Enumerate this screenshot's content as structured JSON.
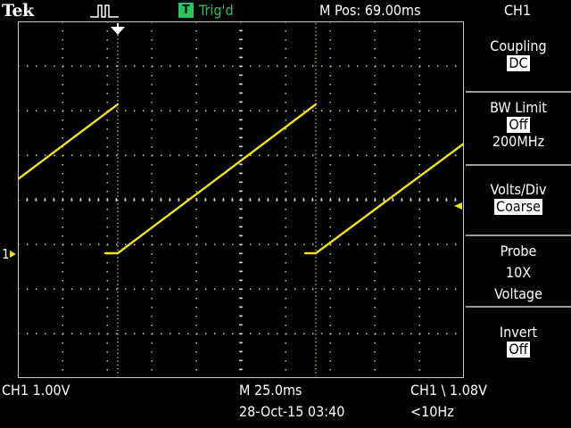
{
  "header": {
    "brand": "Tek",
    "trigger_box": "T",
    "trigger_status": "Trig'd",
    "position": "M Pos: 69.00ms",
    "menu_title": "CH1"
  },
  "menu": [
    {
      "label": "Coupling",
      "value": "DC"
    },
    {
      "label": "BW Limit",
      "value": "Off",
      "extra": "200MHz"
    },
    {
      "label": "Volts/Div",
      "value": "Coarse"
    },
    {
      "label": "Probe",
      "line2": "10X",
      "line3": "Voltage"
    },
    {
      "label": "Invert",
      "value": "Off"
    }
  ],
  "footer": {
    "ch1_scale": "CH1  1.00V",
    "timebase": "M 25.0ms",
    "datetime": "28-Oct-15 03:40",
    "trigger_info": "CH1 \\ 1.08V",
    "frequency": "<10Hz"
  },
  "markers": {
    "channel_marker": "1",
    "trigger_level_marker": "◀"
  },
  "colors": {
    "trace": "#f0e31a",
    "grid": "#c8c8c8",
    "trigger_green": "#29c35f"
  }
}
